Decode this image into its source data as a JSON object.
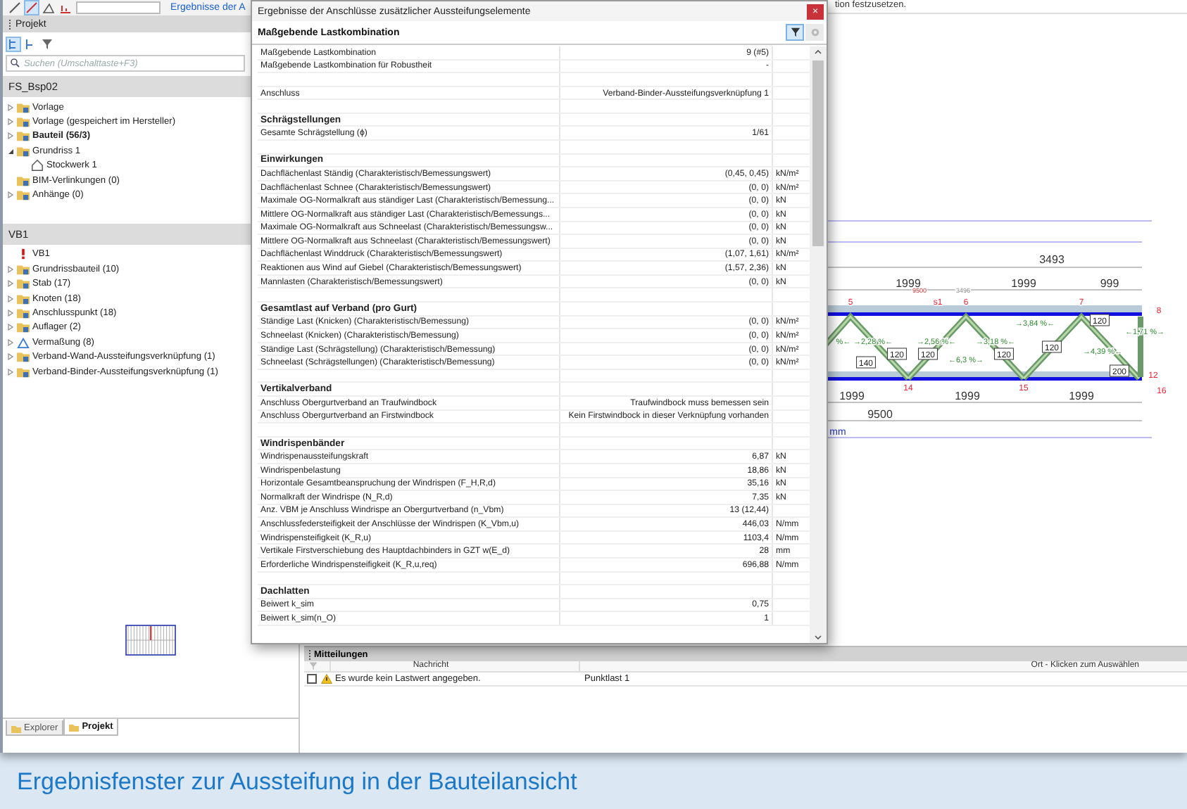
{
  "toolbar": {
    "link": "Ergebnisse der A"
  },
  "top_hint": "tion festzusetzen.",
  "project_panel": {
    "title": "Projekt",
    "search": {
      "placeholder": "Suchen (Umschalttaste+F3)"
    },
    "project": {
      "name": "FS_Bsp02",
      "items": [
        {
          "label": "Vorlage",
          "kind": "folder",
          "expanded": false,
          "bold": false
        },
        {
          "label": "Vorlage (gespeichert im Hersteller)",
          "kind": "folder",
          "expanded": false,
          "bold": false
        },
        {
          "label": "Bauteil (56/3)",
          "kind": "folder",
          "expanded": false,
          "bold": true
        },
        {
          "label": "Grundriss 1",
          "kind": "folder",
          "expanded": true,
          "bold": false,
          "children": [
            {
              "label": "Stockwerk 1",
              "kind": "house",
              "bold": false
            }
          ]
        },
        {
          "label": "BIM-Verlinkungen (0)",
          "kind": "folder",
          "bold": false
        },
        {
          "label": "Anhänge (0)",
          "kind": "folder",
          "expanded": false,
          "bold": false
        }
      ]
    },
    "component": {
      "name": "VB1",
      "items": [
        {
          "label": "VB1",
          "kind": "alert",
          "bold": false
        },
        {
          "label": "Grundrissbauteil (10)",
          "kind": "folder",
          "expanded": false,
          "bold": false
        },
        {
          "label": "Stab (17)",
          "kind": "folder",
          "expanded": false,
          "bold": false
        },
        {
          "label": "Knoten (18)",
          "kind": "folder",
          "expanded": false,
          "bold": false
        },
        {
          "label": "Anschlusspunkt (18)",
          "kind": "folder",
          "expanded": false,
          "bold": false
        },
        {
          "label": "Auflager (2)",
          "kind": "folder",
          "expanded": false,
          "bold": false
        },
        {
          "label": "Vermaßung (8)",
          "kind": "measure",
          "expanded": false,
          "bold": false
        },
        {
          "label": "Verband-Wand-Aussteifungsverknüpfung (1)",
          "kind": "folder",
          "expanded": false,
          "bold": false
        },
        {
          "label": "Verband-Binder-Aussteifungsverknüpfung (1)",
          "kind": "folder",
          "expanded": false,
          "bold": false
        }
      ]
    },
    "tabs": [
      {
        "label": "Explorer",
        "selected": false
      },
      {
        "label": "Projekt",
        "selected": true
      }
    ]
  },
  "dialog": {
    "title": "Ergebnisse der Anschlüsse zusätzlicher Aussteifungselemente",
    "close": "×",
    "header": "Maßgebende Lastkombination",
    "rows": [
      {
        "kind": "row",
        "label": "Maßgebende Lastkombination",
        "value": "9 (#5)"
      },
      {
        "kind": "row",
        "label": "Maßgebende Lastkombination für Robustheit",
        "value": "-"
      },
      {
        "kind": "blank"
      },
      {
        "kind": "row",
        "label": "Anschluss",
        "value": "Verband-Binder-Aussteifungsverknüpfung 1"
      },
      {
        "kind": "blank"
      },
      {
        "kind": "section",
        "label": "Schrägstellungen"
      },
      {
        "kind": "row",
        "label": "Gesamte Schrägstellung (ϕ)",
        "value": "1/61"
      },
      {
        "kind": "blank"
      },
      {
        "kind": "section",
        "label": "Einwirkungen"
      },
      {
        "kind": "row",
        "label": "Dachflächenlast Ständig (Charakteristisch/Bemessungswert)",
        "value": "(0,45, 0,45)",
        "unit": "kN/m²"
      },
      {
        "kind": "row",
        "label": "Dachflächenlast Schnee (Charakteristisch/Bemessungswert)",
        "value": "(0, 0)",
        "unit": "kN/m²"
      },
      {
        "kind": "row",
        "label": "Maximale OG-Normalkraft aus ständiger Last (Charakteristisch/Bemessung...",
        "value": "(0, 0)",
        "unit": "kN"
      },
      {
        "kind": "row",
        "label": "Mittlere OG-Normalkraft aus ständiger Last (Charakteristisch/Bemessungs...",
        "value": "(0, 0)",
        "unit": "kN"
      },
      {
        "kind": "row",
        "label": "Maximale OG-Normalkraft aus Schneelast (Charakteristisch/Bemessungsw...",
        "value": "(0, 0)",
        "unit": "kN"
      },
      {
        "kind": "row",
        "label": "Mittlere OG-Normalkraft aus Schneelast (Charakteristisch/Bemessungswert)",
        "value": "(0, 0)",
        "unit": "kN"
      },
      {
        "kind": "row",
        "label": "Dachflächenlast Winddruck (Charakteristisch/Bemessungswert)",
        "value": "(1,07, 1,61)",
        "unit": "kN/m²"
      },
      {
        "kind": "row",
        "label": "Reaktionen aus Wind auf Giebel (Charakteristisch/Bemessungswert)",
        "value": "(1,57, 2,36)",
        "unit": "kN"
      },
      {
        "kind": "row",
        "label": "Mannlasten (Charakteristisch/Bemessungswert)",
        "value": "(0, 0)",
        "unit": "kN"
      },
      {
        "kind": "blank"
      },
      {
        "kind": "section",
        "label": "Gesamtlast auf Verband (pro Gurt)"
      },
      {
        "kind": "row",
        "label": "Ständige Last (Knicken) (Charakteristisch/Bemessung)",
        "value": "(0, 0)",
        "unit": "kN/m²"
      },
      {
        "kind": "row",
        "label": "Schneelast (Knicken) (Charakteristisch/Bemessung)",
        "value": "(0, 0)",
        "unit": "kN/m²"
      },
      {
        "kind": "row",
        "label": "Ständige Last (Schrägstellung) (Charakteristisch/Bemessung)",
        "value": "(0, 0)",
        "unit": "kN/m²"
      },
      {
        "kind": "row",
        "label": "Schneelast (Schrägstellungen) (Charakteristisch/Bemessung)",
        "value": "(0, 0)",
        "unit": "kN/m²"
      },
      {
        "kind": "blank"
      },
      {
        "kind": "section",
        "label": "Vertikalverband"
      },
      {
        "kind": "row",
        "label": "Anschluss Obergurtverband an Traufwindbock",
        "value": "Traufwindbock muss bemessen sein"
      },
      {
        "kind": "row",
        "label": "Anschluss Obergurtverband an Firstwindbock",
        "value": "Kein Firstwindbock in dieser Verknüpfung vorhanden"
      },
      {
        "kind": "blank"
      },
      {
        "kind": "section",
        "label": "Windrispenbänder"
      },
      {
        "kind": "row",
        "label": "Windrispenaussteifungskraft",
        "value": "6,87",
        "unit": "kN"
      },
      {
        "kind": "row",
        "label": "Windrispenbelastung",
        "value": "18,86",
        "unit": "kN"
      },
      {
        "kind": "row",
        "label": "Horizontale Gesamtbeanspruchung der Windrispen (F_H,R,d)",
        "value": "35,16",
        "unit": "kN"
      },
      {
        "kind": "row",
        "label": "Normalkraft der Windrispe (N_R,d)",
        "value": "7,35",
        "unit": "kN"
      },
      {
        "kind": "row",
        "label": "Anz. VBM je Anschluss Windrispe an Obergurtverband (n_Vbm)",
        "value": "13 (12,44)"
      },
      {
        "kind": "row",
        "label": "Anschlussfedersteifigkeit der Anschlüsse der Windrispen (K_Vbm,u)",
        "value": "446,03",
        "unit": "N/mm"
      },
      {
        "kind": "row",
        "label": "Windrispensteifigkeit (K_R,u)",
        "value": "1103,4",
        "unit": "N/mm"
      },
      {
        "kind": "row",
        "label": "Vertikale Firstverschiebung des Hauptdachbinders in GZT w(E_d)",
        "value": "28",
        "unit": "mm"
      },
      {
        "kind": "row",
        "label": "Erforderliche Windrispensteifigkeit (K_R,u,req)",
        "value": "696,88",
        "unit": "N/mm"
      },
      {
        "kind": "blank"
      },
      {
        "kind": "section",
        "label": "Dachlatten"
      },
      {
        "kind": "row",
        "label": "Beiwert k_sim",
        "value": "0,75"
      },
      {
        "kind": "row",
        "label": "Beiwert k_sim(n_O)",
        "value": "1"
      }
    ]
  },
  "drawing": {
    "labels": [
      {
        "kind": "dimension",
        "text": "3493"
      },
      {
        "kind": "dimension",
        "text": "1999"
      },
      {
        "kind": "dimension",
        "text": "1999"
      },
      {
        "kind": "dimension",
        "text": "999"
      },
      {
        "kind": "small",
        "text": "9500"
      },
      {
        "kind": "note",
        "text": "3496"
      },
      {
        "kind": "node",
        "text": "5"
      },
      {
        "kind": "node",
        "text": "s1"
      },
      {
        "kind": "node",
        "text": "6"
      },
      {
        "kind": "node",
        "text": "7"
      },
      {
        "kind": "node",
        "text": "8"
      },
      {
        "kind": "member",
        "text": "120"
      },
      {
        "kind": "percent",
        "text": "→3,84 %←"
      },
      {
        "kind": "percent",
        "text": "←1,71 %→"
      },
      {
        "kind": "percent",
        "text": "%←"
      },
      {
        "kind": "percent",
        "text": "→2,28 %←"
      },
      {
        "kind": "percent",
        "text": "→2,56 %←"
      },
      {
        "kind": "percent",
        "text": "→3,18 %←"
      },
      {
        "kind": "member",
        "text": "120"
      },
      {
        "kind": "percent",
        "text": "→4,39 %←"
      },
      {
        "kind": "member",
        "text": "120"
      },
      {
        "kind": "member",
        "text": "120"
      },
      {
        "kind": "member",
        "text": "120"
      },
      {
        "kind": "percent",
        "text": "←6,3 %→"
      },
      {
        "kind": "member",
        "text": "140"
      },
      {
        "kind": "member",
        "text": "200"
      },
      {
        "kind": "node",
        "text": "12"
      },
      {
        "kind": "node",
        "text": "14"
      },
      {
        "kind": "node",
        "text": "15"
      },
      {
        "kind": "node",
        "text": "16"
      },
      {
        "kind": "dimension",
        "text": "1999"
      },
      {
        "kind": "dimension",
        "text": "1999"
      },
      {
        "kind": "dimension",
        "text": "1999"
      },
      {
        "kind": "dimension",
        "text": "9500"
      },
      {
        "kind": "unit",
        "text": "mm"
      }
    ]
  },
  "messages": {
    "title": "Mitteilungen",
    "columns": [
      "Nachricht",
      "Ort - Klicken zum Auswählen"
    ],
    "rows": [
      {
        "checked": false,
        "kind": "warning",
        "message": "Es wurde kein Lastwert angegeben.",
        "location": "Punktlast 1"
      }
    ]
  },
  "caption": "Ergebnisfenster zur Aussteifung in der Bauteilansicht"
}
